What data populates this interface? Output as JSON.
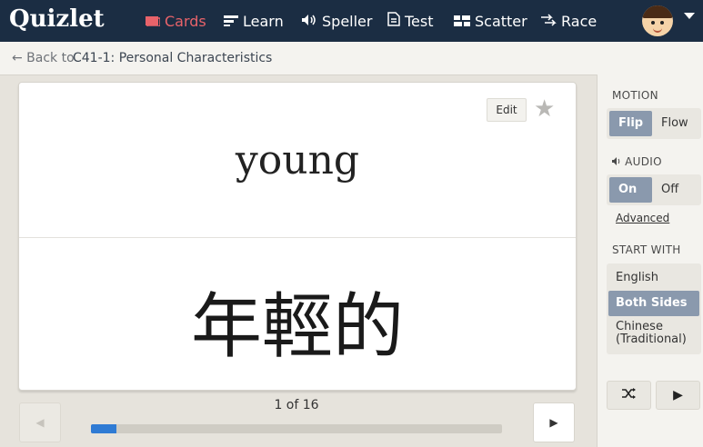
{
  "app": {
    "logo": "Quizlet"
  },
  "nav": [
    {
      "label": "Cards",
      "icon": "cards-icon",
      "active": true
    },
    {
      "label": "Learn",
      "icon": "learn-icon",
      "active": false
    },
    {
      "label": "Speller",
      "icon": "speaker-icon",
      "active": false
    },
    {
      "label": "Test",
      "icon": "test-icon",
      "active": false
    },
    {
      "label": "Scatter",
      "icon": "scatter-icon",
      "active": false
    },
    {
      "label": "Race",
      "icon": "race-icon",
      "active": false
    }
  ],
  "breadcrumb": {
    "back": "← Back to",
    "title": "C41-1: Personal Characteristics"
  },
  "card": {
    "edit_label": "Edit",
    "term": "young",
    "definition": "年輕的"
  },
  "progress": {
    "counter": "1 of 16",
    "current": 1,
    "total": 16
  },
  "sidebar": {
    "motion": {
      "label": "MOTION",
      "options": [
        "Flip",
        "Flow"
      ],
      "selected": "Flip"
    },
    "audio": {
      "label": "AUDIO",
      "options": [
        "On",
        "Off"
      ],
      "selected": "On",
      "advanced": "Advanced"
    },
    "start_with": {
      "label": "START WITH",
      "options": [
        "English",
        "Both Sides",
        "Chinese (Traditional)"
      ],
      "selected": "Both Sides"
    }
  },
  "colors": {
    "topbar": "#1b2d43",
    "active_nav": "#e8636a",
    "toggle_on": "#8a99ad",
    "progress_fill": "#2f7bd4"
  }
}
